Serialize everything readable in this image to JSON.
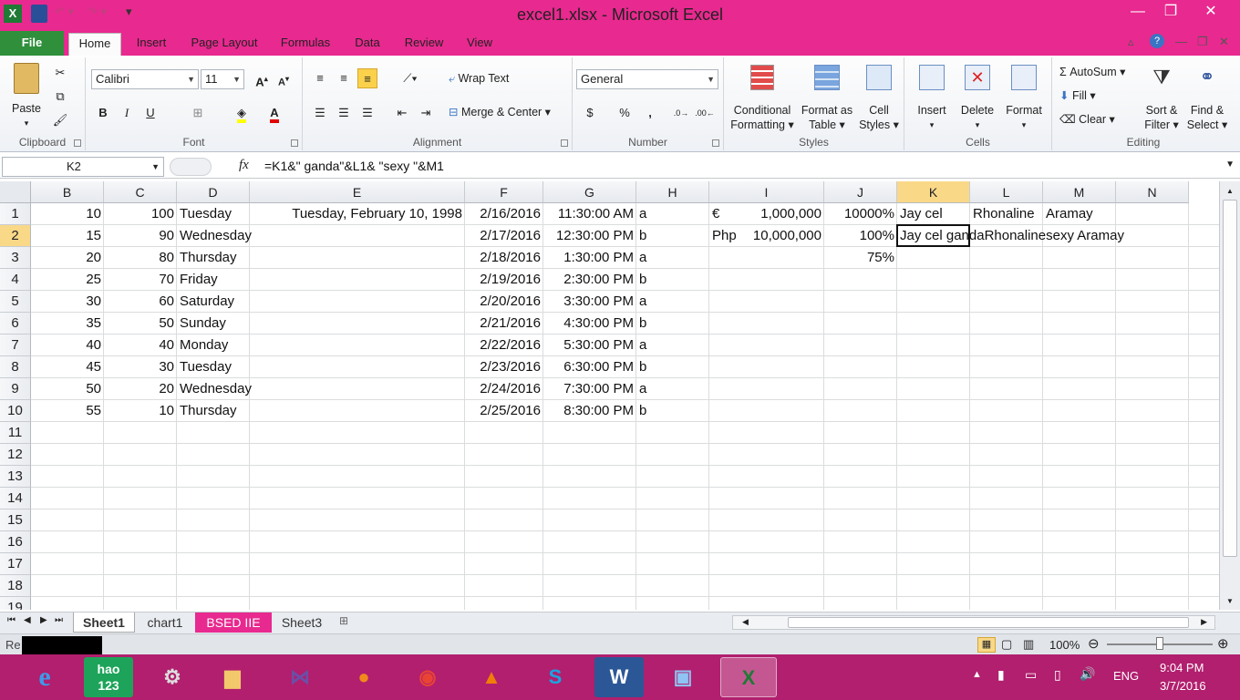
{
  "window": {
    "title": "excel1.xlsx - Microsoft Excel"
  },
  "tabs": [
    "File",
    "Home",
    "Insert",
    "Page Layout",
    "Formulas",
    "Data",
    "Review",
    "View"
  ],
  "ribbon": {
    "clipboard": {
      "label": "Clipboard",
      "paste": "Paste"
    },
    "font": {
      "label": "Font",
      "name": "Calibri",
      "size": "11",
      "bold": "B",
      "italic": "I",
      "underline": "U"
    },
    "alignment": {
      "label": "Alignment",
      "wrap": "Wrap Text",
      "merge": "Merge & Center"
    },
    "number": {
      "label": "Number",
      "format": "General",
      "currency": "$",
      "percent": "%",
      "comma": ","
    },
    "styles": {
      "label": "Styles",
      "conditional": [
        "Conditional",
        "Formatting"
      ],
      "format_table": [
        "Format as",
        "Table"
      ],
      "cell_styles": [
        "Cell",
        "Styles"
      ]
    },
    "cells": {
      "label": "Cells",
      "insert": "Insert",
      "delete": "Delete",
      "format": "Format"
    },
    "editing": {
      "label": "Editing",
      "autosum": "AutoSum",
      "fill": "Fill",
      "clear": "Clear",
      "sort": [
        "Sort &",
        "Filter"
      ],
      "find": [
        "Find &",
        "Select"
      ]
    }
  },
  "formula_bar": {
    "name_box": "K2",
    "fx": "fx",
    "formula": "=K1&\" ganda\"&L1& \"sexy \"&M1"
  },
  "columns": [
    "B",
    "C",
    "D",
    "E",
    "F",
    "G",
    "H",
    "I",
    "J",
    "K",
    "L",
    "M",
    "N"
  ],
  "rows": [
    "1",
    "2",
    "3",
    "4",
    "5",
    "6",
    "7",
    "8",
    "9",
    "10",
    "11",
    "12",
    "13",
    "14",
    "15",
    "16",
    "17",
    "18",
    "19"
  ],
  "cells": {
    "B": [
      "10",
      "15",
      "20",
      "25",
      "30",
      "35",
      "40",
      "45",
      "50",
      "55"
    ],
    "C": [
      "100",
      "90",
      "80",
      "70",
      "60",
      "50",
      "40",
      "30",
      "20",
      "10"
    ],
    "D": [
      "Tuesday",
      "Wednesday",
      "Thursday",
      "Friday",
      "Saturday",
      "Sunday",
      "Monday",
      "Tuesday",
      "Wednesday",
      "Thursday"
    ],
    "E": [
      "Tuesday, February 10, 1998"
    ],
    "F": [
      "2/16/2016",
      "2/17/2016",
      "2/18/2016",
      "2/19/2016",
      "2/20/2016",
      "2/21/2016",
      "2/22/2016",
      "2/23/2016",
      "2/24/2016",
      "2/25/2016"
    ],
    "G": [
      "11:30:00 AM",
      "12:30:00 PM",
      "1:30:00 PM",
      "2:30:00 PM",
      "3:30:00 PM",
      "4:30:00 PM",
      "5:30:00 PM",
      "6:30:00 PM",
      "7:30:00 PM",
      "8:30:00 PM"
    ],
    "H": [
      "a",
      "b",
      "a",
      "b",
      "a",
      "b",
      "a",
      "b",
      "a",
      "b"
    ],
    "I1_sym": "€",
    "I1_val": "1,000,000",
    "I2_sym": "Php",
    "I2_val": "10,000,000",
    "J": [
      "10000%",
      "100%",
      "75%"
    ],
    "K1": "Jay cel",
    "L1": "Rhonaline",
    "M1": "Aramay",
    "K2": "Jay cel gandaRhonalinesexy Aramay"
  },
  "sheets": [
    "Sheet1",
    "chart1",
    "BSED IIE",
    "Sheet3"
  ],
  "status": {
    "left": "Re",
    "zoom": "100%"
  },
  "tray": {
    "lang": "ENG",
    "time": "9:04 PM",
    "date": "3/7/2016"
  }
}
